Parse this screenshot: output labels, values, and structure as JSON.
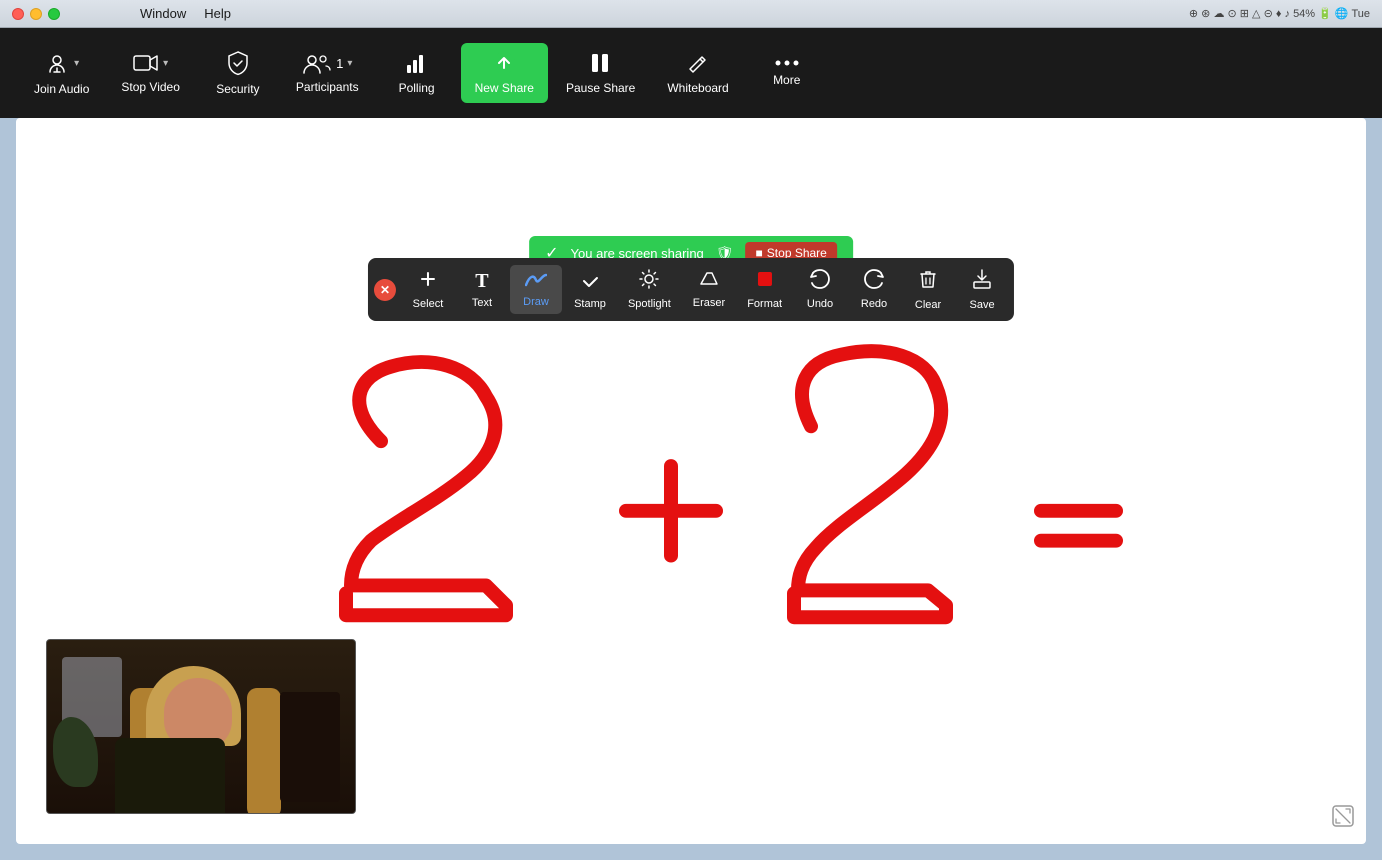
{
  "titlebar": {
    "menus": [
      "Window",
      "Help"
    ],
    "trafficLights": [
      "close",
      "minimize",
      "maximize"
    ],
    "rightItems": [
      "54%",
      "Tue"
    ]
  },
  "zoomToolbar": {
    "items": [
      {
        "id": "join-audio",
        "label": "Join Audio",
        "icon": "🎧",
        "hasChevron": true
      },
      {
        "id": "stop-video",
        "label": "Stop Video",
        "icon": "📷",
        "hasChevron": true
      },
      {
        "id": "security",
        "label": "Security",
        "icon": "🛡",
        "hasChevron": false
      },
      {
        "id": "participants",
        "label": "Participants",
        "icon": "👥",
        "hasChevron": true,
        "count": "1"
      },
      {
        "id": "polling",
        "label": "Polling",
        "icon": "📊",
        "hasChevron": false
      },
      {
        "id": "new-share",
        "label": "New Share",
        "icon": "↑",
        "hasChevron": false,
        "highlight": true
      },
      {
        "id": "pause-share",
        "label": "Pause Share",
        "icon": "⏸",
        "hasChevron": false
      },
      {
        "id": "whiteboard",
        "label": "Whiteboard",
        "icon": "✏",
        "hasChevron": false
      },
      {
        "id": "more",
        "label": "More",
        "icon": "•••",
        "hasChevron": false
      }
    ]
  },
  "shareBanner": {
    "checkIcon": "✓",
    "shieldIcon": "🛡",
    "text": "You are screen sharing",
    "stopLabel": "Stop Share",
    "stopIcon": "■"
  },
  "annotationToolbar": {
    "tools": [
      {
        "id": "select",
        "label": "Select",
        "icon": "✛"
      },
      {
        "id": "text",
        "label": "Text",
        "icon": "T"
      },
      {
        "id": "draw",
        "label": "Draw",
        "icon": "〜",
        "active": true
      },
      {
        "id": "stamp",
        "label": "Stamp",
        "icon": "✓"
      },
      {
        "id": "spotlight",
        "label": "Spotlight",
        "icon": "✦"
      },
      {
        "id": "eraser",
        "label": "Eraser",
        "icon": "◇"
      },
      {
        "id": "format",
        "label": "Format",
        "icon": "■"
      },
      {
        "id": "undo",
        "label": "Undo",
        "icon": "↩"
      },
      {
        "id": "redo",
        "label": "Redo",
        "icon": "↪"
      },
      {
        "id": "clear",
        "label": "Clear",
        "icon": "🗑"
      },
      {
        "id": "save",
        "label": "Save",
        "icon": "⬇"
      }
    ]
  },
  "whiteboard": {
    "formula": "2 + 2 =",
    "drawingColor": "#e41010"
  },
  "videoThumbnail": {
    "label": "Participant video"
  }
}
